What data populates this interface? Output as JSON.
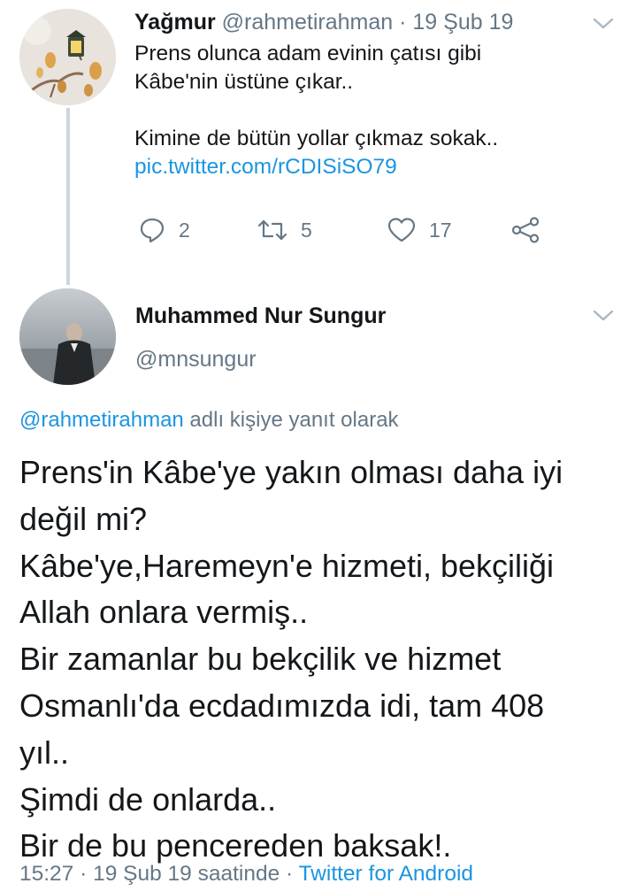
{
  "parent_tweet": {
    "display_name": "Yağmur",
    "handle": "@rahmetirahman",
    "separator": "·",
    "date": "19 Şub 19",
    "lines": [
      "Prens olunca adam evinin çatısı gibi",
      "Kâbe'nin üstüne çıkar..",
      "",
      "Kimine de bütün yollar çıkmaz sokak.."
    ],
    "link": "pic.twitter.com/rCDISiSO79",
    "reply_count": "2",
    "retweet_count": "5",
    "like_count": "17"
  },
  "reply_tweet": {
    "display_name": "Muhammed Nur Sungur",
    "handle": "@mnsungur",
    "replying_mention": "@rahmetirahman",
    "replying_suffix": " adlı kişiye yanıt olarak",
    "lines": [
      "Prens'in Kâbe'ye yakın olması daha iyi",
      "değil mi?",
      "Kâbe'ye,Haremeyn'e hizmeti, bekçiliği",
      "Allah onlara vermiş..",
      "Bir zamanlar bu bekçilik ve hizmet",
      "Osmanlı'da ecdadımızda idi, tam 408",
      "yıl..",
      "Şimdi de onlarda..",
      "Bir de bu pencereden baksak!."
    ],
    "footer_time_date": "15:27 · 19 Şub 19 saatinde · ",
    "footer_source": "Twitter for Android"
  },
  "colors": {
    "link": "#1b95e0",
    "secondary": "#657786",
    "text": "#14171a",
    "thread_line": "#ccd6dd"
  }
}
